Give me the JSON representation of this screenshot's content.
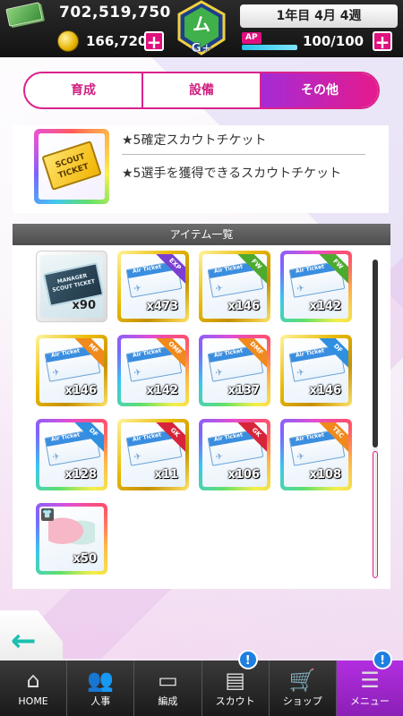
{
  "header": {
    "money": "702,519,750",
    "coins": "166,720",
    "week": "1年目 4月 4週",
    "ap_label": "AP",
    "ap_value": "100/100",
    "emblem_text": "G+",
    "plus_label": "+"
  },
  "tabs": [
    {
      "label": "育成",
      "active": false
    },
    {
      "label": "設備",
      "active": false
    },
    {
      "label": "その他",
      "active": true
    }
  ],
  "info": {
    "title": "★5確定スカウトチケット",
    "description": "★5選手を獲得できるスカウトチケット",
    "ticket_text": "SCOUT TICKET"
  },
  "list": {
    "header": "アイテム一覧",
    "air_ticket_label": "Air Ticket",
    "manager_ticket_text": "MANAGER SCOUT TICKET",
    "items": [
      {
        "count": "x90",
        "frame": "plain",
        "kind": "manager",
        "tag": ""
      },
      {
        "count": "x473",
        "frame": "gold",
        "kind": "air",
        "tag": "EXP",
        "tag_color": "#7a3fd0"
      },
      {
        "count": "x146",
        "frame": "gold",
        "kind": "air",
        "tag": "FW",
        "tag_color": "#4caa2e"
      },
      {
        "count": "x142",
        "frame": "rainbow",
        "kind": "air",
        "tag": "FW",
        "tag_color": "#4caa2e"
      },
      {
        "count": "x146",
        "frame": "gold",
        "kind": "air",
        "tag": "MF",
        "tag_color": "#f08a1c"
      },
      {
        "count": "x142",
        "frame": "rainbow",
        "kind": "air",
        "tag": "OMF",
        "tag_color": "#f08a1c"
      },
      {
        "count": "x137",
        "frame": "rainbow",
        "kind": "air",
        "tag": "DMF",
        "tag_color": "#f08a1c"
      },
      {
        "count": "x146",
        "frame": "gold",
        "kind": "air",
        "tag": "DF",
        "tag_color": "#2f8fe0"
      },
      {
        "count": "x128",
        "frame": "rainbow",
        "kind": "air",
        "tag": "DF",
        "tag_color": "#2f8fe0"
      },
      {
        "count": "x11",
        "frame": "gold",
        "kind": "air",
        "tag": "GK",
        "tag_color": "#d8243a"
      },
      {
        "count": "x106",
        "frame": "rainbow",
        "kind": "air",
        "tag": "GK",
        "tag_color": "#d8243a"
      },
      {
        "count": "x108",
        "frame": "rainbow",
        "kind": "air",
        "tag": "TEC",
        "tag_color": "#f08a1c"
      },
      {
        "count": "x50",
        "frame": "rainbow",
        "kind": "outfit",
        "tag": ""
      }
    ]
  },
  "scroll_position": 0.0,
  "nav": [
    {
      "label": "HOME",
      "icon": "home-icon",
      "glyph": "⌂",
      "active": false,
      "notify": ""
    },
    {
      "label": "人事",
      "icon": "people-icon",
      "glyph": "👥",
      "active": false,
      "notify": ""
    },
    {
      "label": "編成",
      "icon": "pitch-icon",
      "glyph": "▭",
      "active": false,
      "notify": ""
    },
    {
      "label": "スカウト",
      "icon": "scout-icon",
      "glyph": "▤",
      "active": false,
      "notify": "!"
    },
    {
      "label": "ショップ",
      "icon": "cart-icon",
      "glyph": "🛒",
      "active": false,
      "notify": ""
    },
    {
      "label": "メニュー",
      "icon": "menu-icon",
      "glyph": "☰",
      "active": true,
      "notify": "!"
    }
  ],
  "back": {
    "glyph": "←"
  }
}
